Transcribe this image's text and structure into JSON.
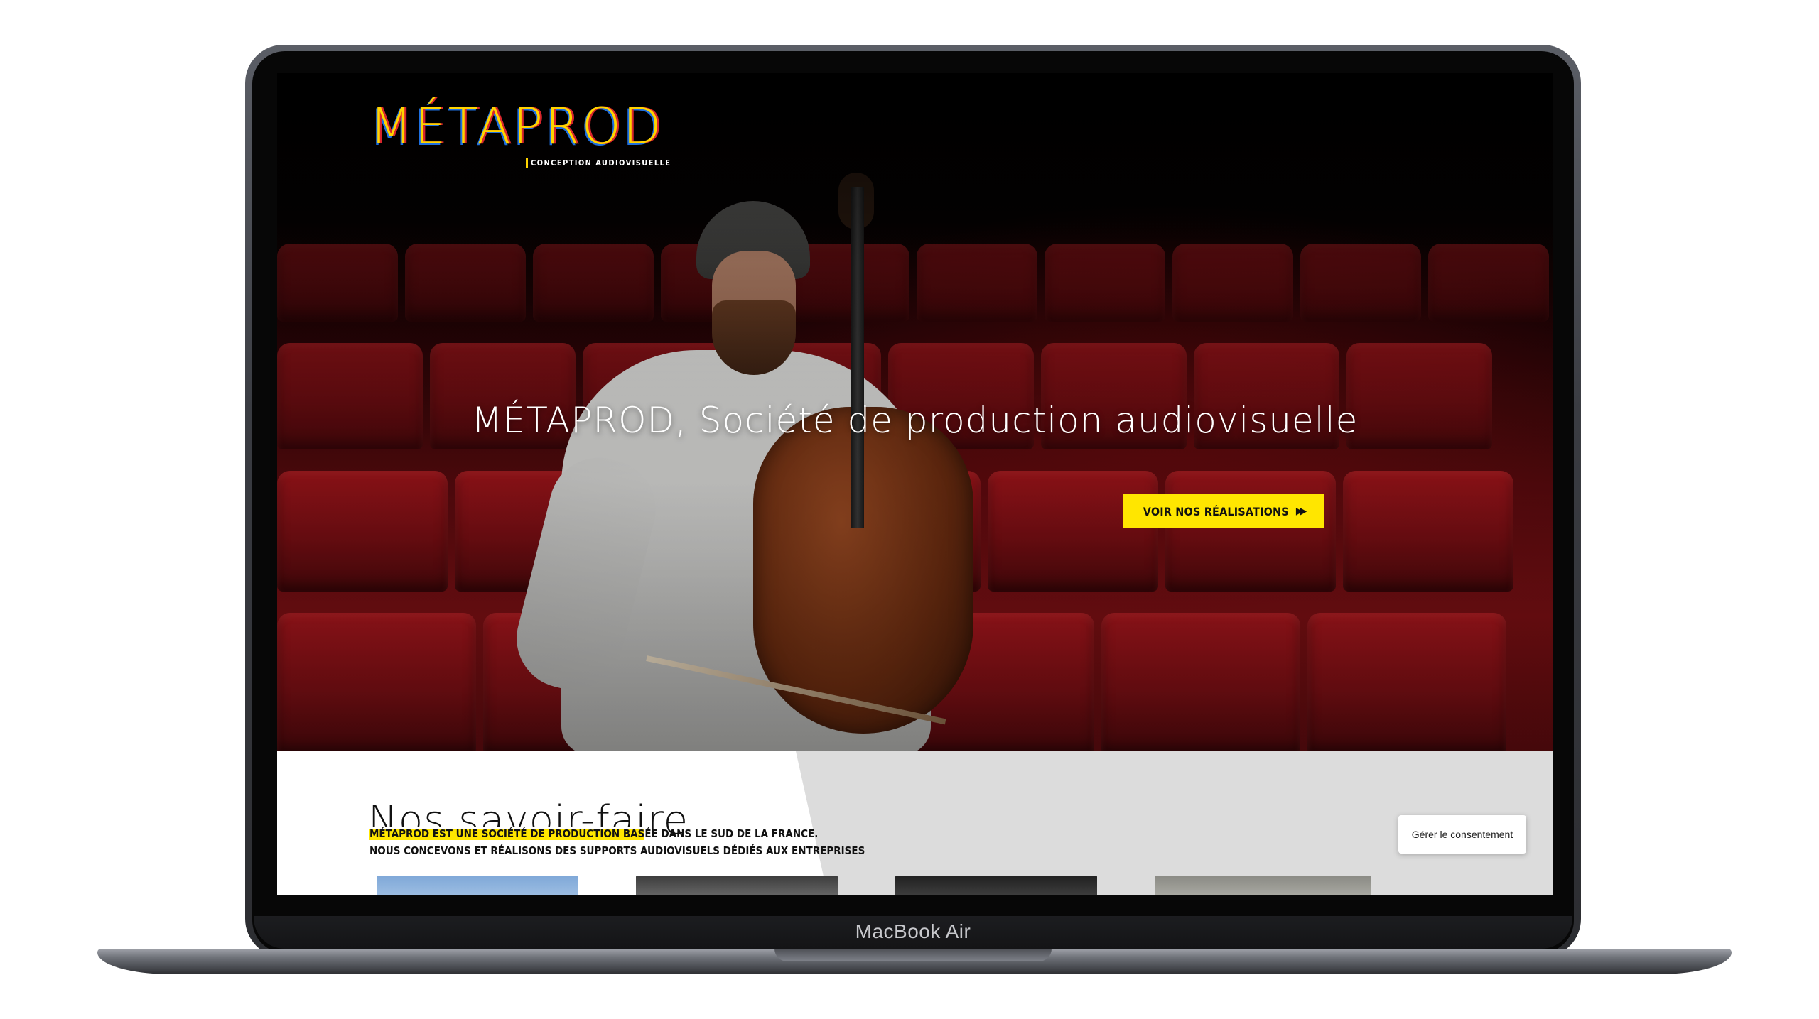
{
  "device": {
    "model_label": "MacBook Air"
  },
  "site": {
    "logo": {
      "word": "MÉTAPROD",
      "tagline": "CONCEPTION AUDIOVISUELLE"
    },
    "hero": {
      "title": "MÉTAPROD, Société de production audiovisuelle",
      "cta_label": "VOIR NOS RÉALISATIONS",
      "cta_icon": "double-chevron-right-icon"
    },
    "savoir_faire": {
      "title": "Nos savoir-faire",
      "line1_highlight": "MÉTAPROD EST UNE SOCIÉTÉ DE PRODUCTION BAS",
      "line1_rest": "ÉE DANS LE SUD DE LA FRANCE.",
      "line2": "NOUS CONCEVONS ET RÉALISONS DES SUPPORTS AUDIOVISUELS DÉDIÉS AUX ENTREPRISES"
    },
    "consent": {
      "label": "Gérer le consentement"
    }
  },
  "colors": {
    "accent_yellow": "#ffe600",
    "logo_red": "#d8262c",
    "logo_blue": "#1e6fe0",
    "seat_red": "#7c0f14"
  }
}
